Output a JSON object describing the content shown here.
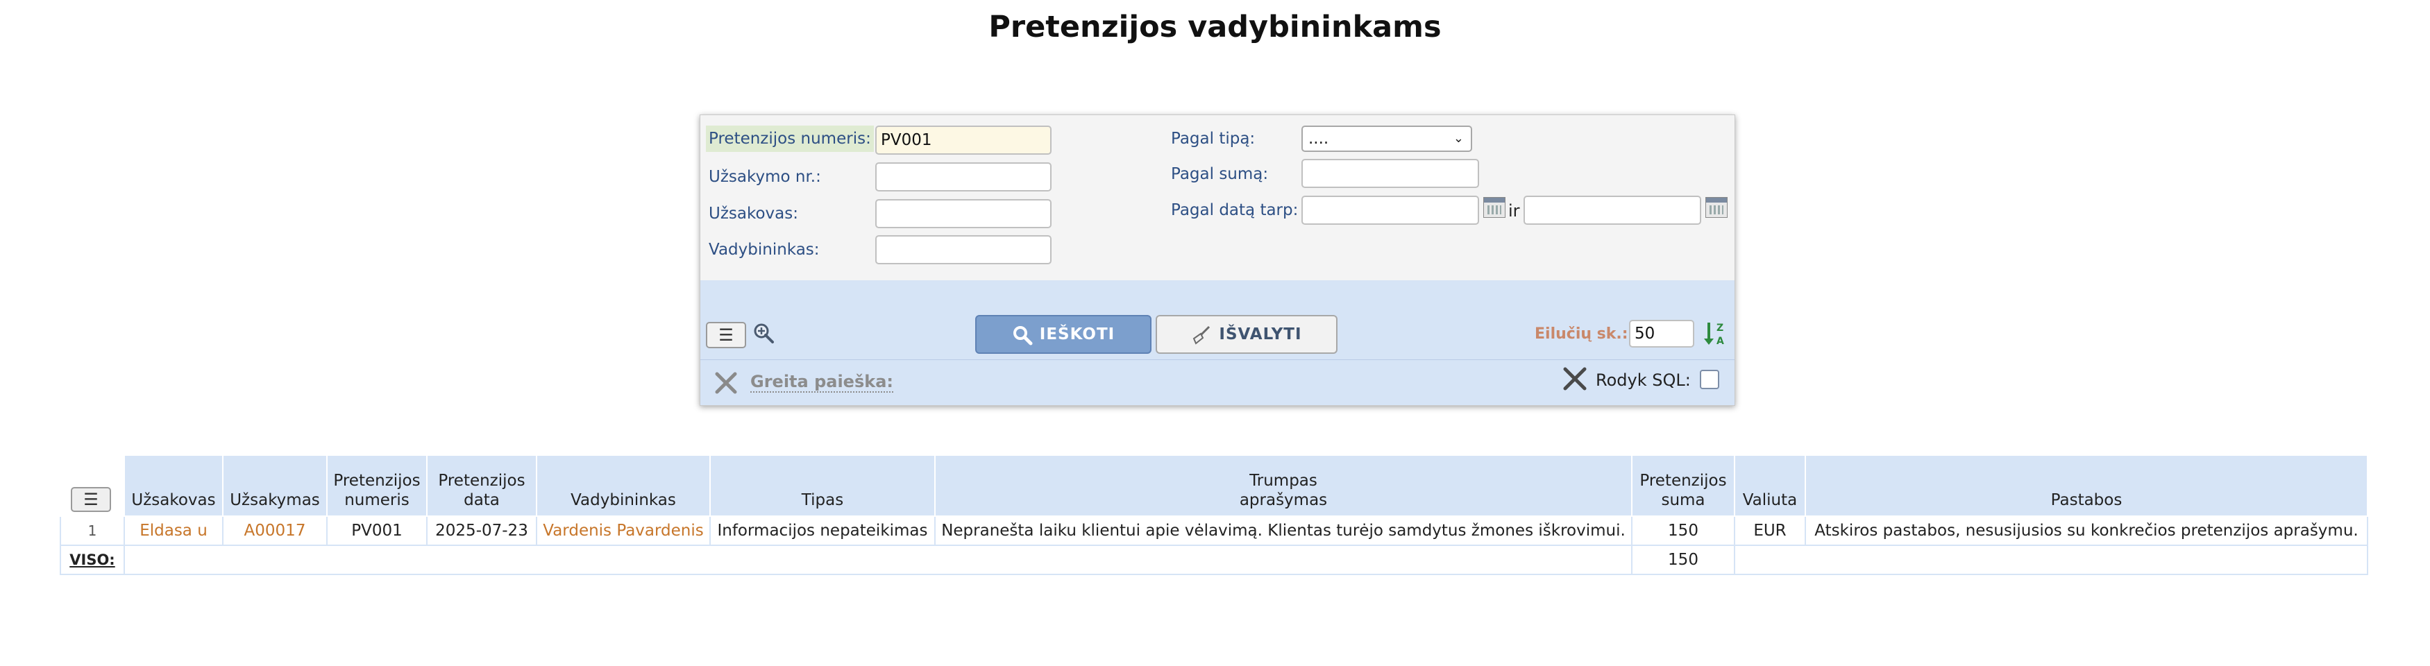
{
  "page": {
    "title": "Pretenzijos vadybininkams"
  },
  "search": {
    "claim_no_label": "Pretenzijos numeris:",
    "claim_no_value": "PV001",
    "order_no_label": "Užsakymo nr.:",
    "order_no_value": "",
    "customer_label": "Užsakovas:",
    "customer_value": "",
    "manager_label": "Vadybininkas:",
    "manager_value": "",
    "type_label": "Pagal tipą:",
    "type_value": "....",
    "sum_label": "Pagal sumą:",
    "sum_value": "",
    "date_label": "Pagal datą tarp:",
    "date_from": "",
    "date_and": "ir",
    "date_to": "",
    "search_button": "IEŠKOTI",
    "clear_button": "IŠVALYTI",
    "rows_label": "Eilučių sk.:",
    "rows_value": "50",
    "quick_search_label": "Greita paieška:",
    "show_sql_label": "Rodyk SQL:",
    "menu_icon": "hamburger-menu-icon",
    "zoom_icon": "zoom-in-icon",
    "sort_icon": "sort-za-icon",
    "tools_icon": "tools-icon"
  },
  "table": {
    "headers": {
      "customer": "Užsakovas",
      "order": "Užsakymas",
      "claim_no_1": "Pretenzijos",
      "claim_no_2": "numeris",
      "claim_date_1": "Pretenzijos",
      "claim_date_2": "data",
      "manager": "Vadybininkas",
      "type": "Tipas",
      "desc_1": "Trumpas",
      "desc_2": "aprašymas",
      "sum_1": "Pretenzijos",
      "sum_2": "suma",
      "currency": "Valiuta",
      "notes": "Pastabos"
    },
    "rows": [
      {
        "num": "1",
        "customer": "Eldasa u",
        "order": "A00017",
        "claim_no": "PV001",
        "date": "2025-07-23",
        "manager": "Vardenis Pavardenis",
        "type": "Informacijos nepateikimas",
        "description": "Nepranešta laiku klientui apie vėlavimą. Klientas turėjo samdytus žmones iškrovimui.",
        "sum": "150",
        "currency": "EUR",
        "notes": "Atskiros pastabos, nesusijusios su konkrečios pretenzijos aprašymu."
      }
    ],
    "total_label": "VISO:",
    "total_sum": "150"
  },
  "colors": {
    "accent_blue": "#7c9fcd",
    "panel_blue": "#d6e4f6",
    "link_orange": "#c7762a",
    "label_blue": "#2d4f84"
  }
}
